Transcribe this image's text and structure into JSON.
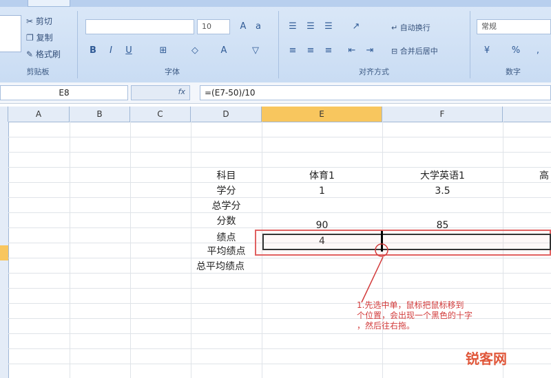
{
  "ribbon": {
    "clipboard": {
      "cut": "剪切",
      "copy": "复制",
      "painter": "格式刷",
      "label": "剪贴板"
    },
    "font": {
      "label": "字体",
      "size": "10"
    },
    "alignment": {
      "wrap": "自动换行",
      "merge": "合并后居中",
      "label": "对齐方式"
    },
    "number": {
      "format": "常规",
      "label": "数字"
    }
  },
  "formula_bar": {
    "cell_ref": "E8",
    "fx": "fx",
    "formula": "=(E7-50)/10"
  },
  "columns": [
    "A",
    "B",
    "C",
    "D",
    "E",
    "F"
  ],
  "cells": {
    "d_labels": [
      "科目",
      "学分",
      "总学分",
      "分数",
      "绩点",
      "平均绩点",
      "总平均绩点"
    ],
    "e_values": [
      "体育1",
      "1",
      "",
      "90",
      "4"
    ],
    "f_values": [
      "大学英语1",
      "3.5",
      "",
      "85",
      ""
    ],
    "g_partial": "高"
  },
  "annotation": {
    "line1": "1.先选中单，鼠标把鼠标移到",
    "line2": "个位置，会出现一个黑色的十字",
    "line3": "，然后往右拖。"
  },
  "watermark": "锐客网",
  "colors": {
    "accent": "#f8c65e",
    "annotation": "#d23b3b"
  }
}
